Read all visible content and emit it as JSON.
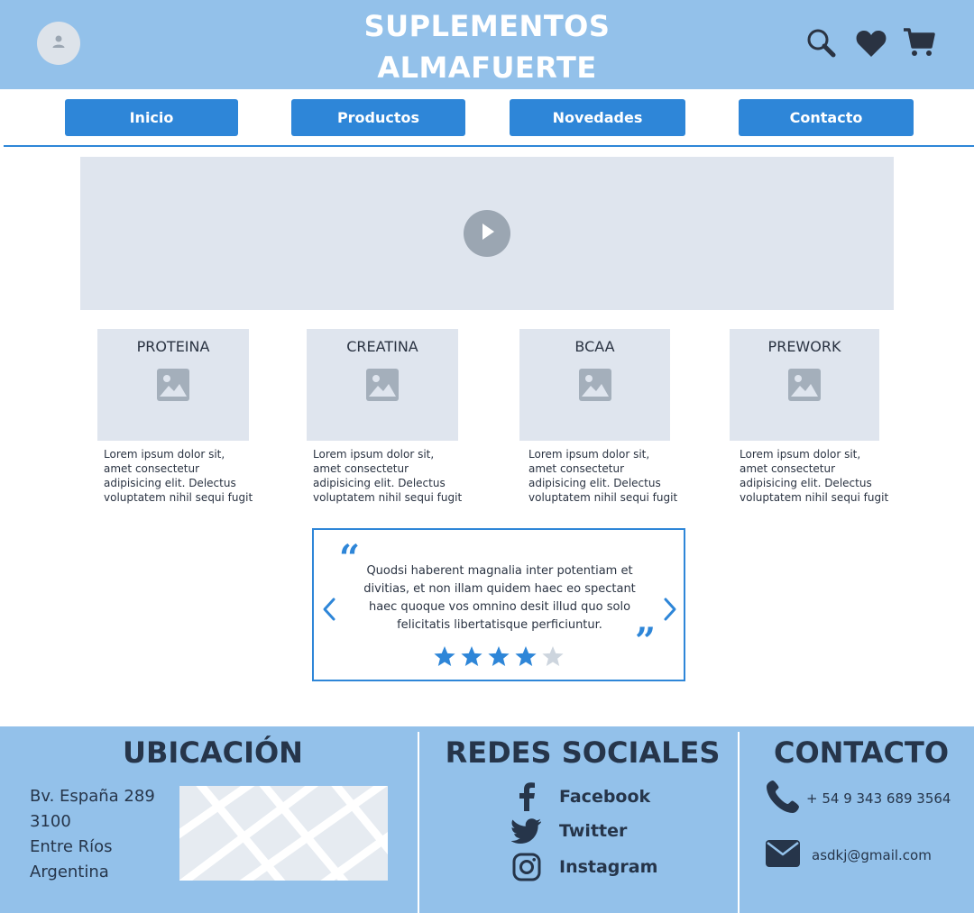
{
  "header": {
    "brand_line1": "SUPLEMENTOS",
    "brand_line2": "ALMAFUERTE",
    "icons": [
      "user-icon",
      "search-icon",
      "heart-icon",
      "cart-icon"
    ]
  },
  "nav": {
    "items": [
      {
        "label": "Inicio"
      },
      {
        "label": "Productos"
      },
      {
        "label": "Novedades"
      },
      {
        "label": "Contacto"
      }
    ]
  },
  "products": [
    {
      "title": "PROTEINA",
      "lines": [
        "Lorem ipsum dolor sit,",
        "amet consectetur",
        "adipisicing elit. Delectus",
        "voluptatem nihil sequi fugit"
      ]
    },
    {
      "title": "CREATINA",
      "lines": [
        "Lorem ipsum dolor sit,",
        "amet consectetur",
        "adipisicing elit. Delectus",
        "voluptatem nihil sequi fugit"
      ]
    },
    {
      "title": "BCAA",
      "lines": [
        "Lorem ipsum dolor sit,",
        "amet consectetur",
        "adipisicing elit. Delectus",
        "voluptatem nihil sequi fugit"
      ]
    },
    {
      "title": "PREWORK",
      "lines": [
        "Lorem ipsum dolor sit,",
        "amet consectetur",
        "adipisicing elit. Delectus",
        "voluptatem nihil sequi fugit"
      ]
    }
  ],
  "testimonial": {
    "lines": [
      "Quodsi haberent magnalia inter potentiam et",
      "divitias, et non illam quidem haec eo spectant",
      "haec quoque vos omnino desit illud quo solo",
      "felicitatis libertatisque perficiuntur."
    ],
    "rating": 4,
    "max_rating": 5
  },
  "footer": {
    "location": {
      "heading": "UBICACIÓN",
      "address": [
        "Bv. España 289",
        "3100",
        "Entre Ríos",
        "Argentina"
      ]
    },
    "social": {
      "heading": "REDES SOCIALES",
      "items": [
        {
          "label": "Facebook",
          "icon": "facebook-icon"
        },
        {
          "label": "Twitter",
          "icon": "twitter-icon"
        },
        {
          "label": "Instagram",
          "icon": "instagram-icon"
        }
      ]
    },
    "contact": {
      "heading": "CONTACTO",
      "phone": "+ 54 9 343 689 3564",
      "email": "asdkj@gmail.com"
    }
  },
  "colors": {
    "header_bg": "#93c1ea",
    "accent": "#2e86d8",
    "placeholder_bg": "#dfe5ee",
    "star_filled": "#2e86d8",
    "star_empty": "#cdd5de",
    "dark_text": "#26354a"
  }
}
